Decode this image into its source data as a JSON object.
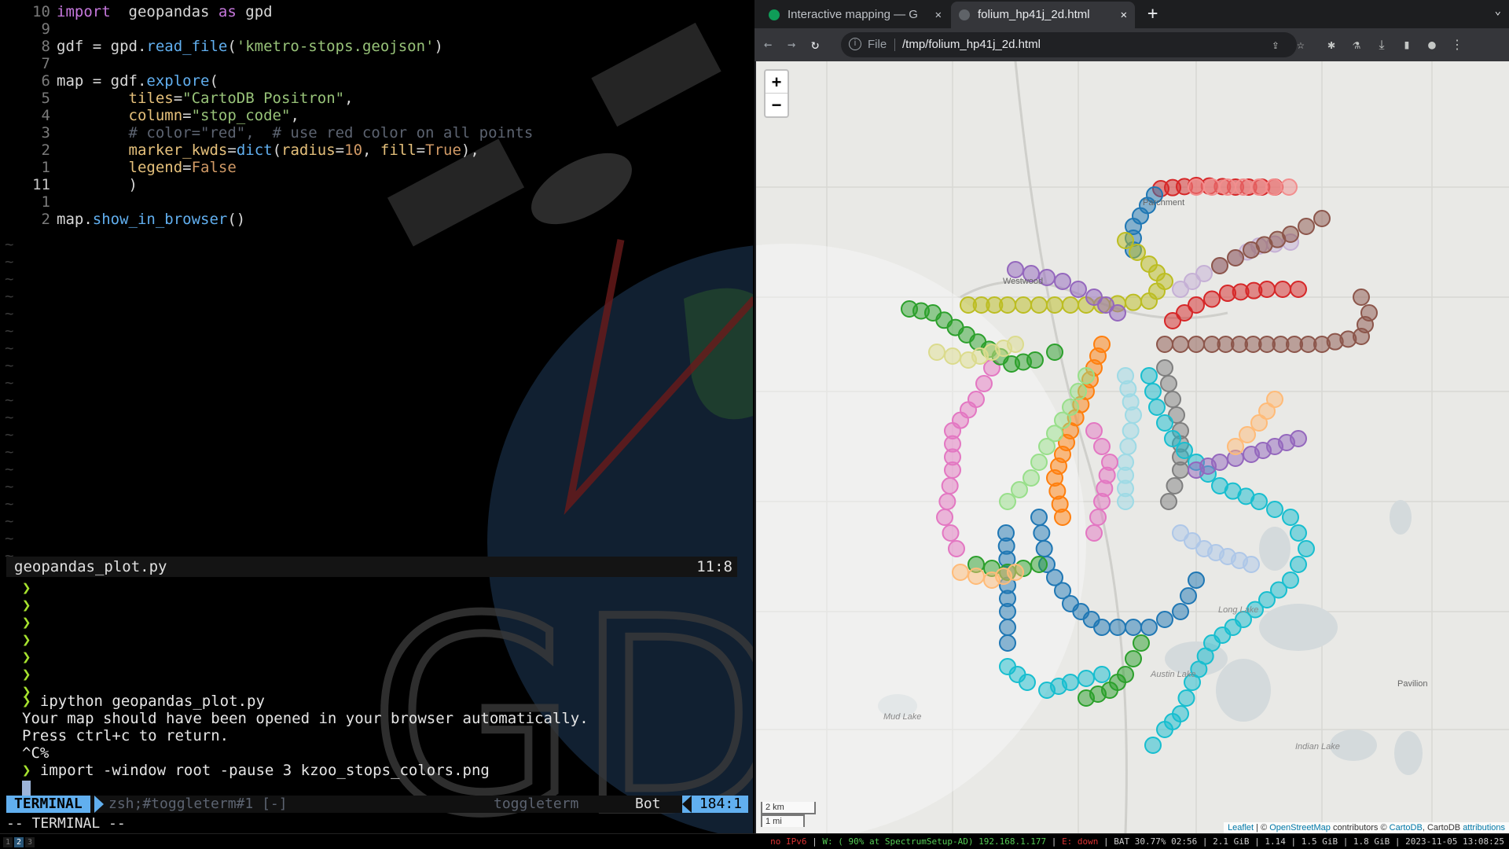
{
  "editor": {
    "lines": [
      {
        "num": "10",
        "parts": [
          [
            "kw",
            "import"
          ],
          [
            "",
            "  geopandas "
          ],
          [
            "kw",
            "as"
          ],
          [
            "",
            " gpd"
          ]
        ]
      },
      {
        "num": "9",
        "parts": []
      },
      {
        "num": "8",
        "parts": [
          [
            "",
            "gdf = gpd."
          ],
          [
            "fn",
            "read_file"
          ],
          [
            "",
            "("
          ],
          [
            "str",
            "'kmetro-stops.geojson'"
          ],
          [
            "",
            ")"
          ]
        ]
      },
      {
        "num": "7",
        "parts": []
      },
      {
        "num": "6",
        "parts": [
          [
            "",
            "map = gdf."
          ],
          [
            "fn",
            "explore"
          ],
          [
            "",
            "("
          ]
        ]
      },
      {
        "num": "5",
        "parts": [
          [
            "",
            "        "
          ],
          [
            "arg",
            "tiles"
          ],
          [
            "",
            "="
          ],
          [
            "str",
            "\"CartoDB Positron\""
          ],
          [
            "",
            ","
          ]
        ]
      },
      {
        "num": "4",
        "parts": [
          [
            "",
            "        "
          ],
          [
            "arg",
            "column"
          ],
          [
            "",
            "="
          ],
          [
            "str",
            "\"stop_code\""
          ],
          [
            "",
            ","
          ]
        ]
      },
      {
        "num": "3",
        "parts": [
          [
            "",
            "        "
          ],
          [
            "cm",
            "# color=\"red\",  # use red color on all points"
          ]
        ]
      },
      {
        "num": "2",
        "parts": [
          [
            "",
            "        "
          ],
          [
            "arg",
            "marker_kwds"
          ],
          [
            "",
            "="
          ],
          [
            "fn",
            "dict"
          ],
          [
            "",
            "("
          ],
          [
            "arg",
            "radius"
          ],
          [
            "",
            "="
          ],
          [
            "num",
            "10"
          ],
          [
            "",
            ", "
          ],
          [
            "arg",
            "fill"
          ],
          [
            "",
            "="
          ],
          [
            "bl",
            "True"
          ],
          [
            "",
            "),"
          ]
        ]
      },
      {
        "num": "1",
        "parts": [
          [
            "",
            "        "
          ],
          [
            "arg",
            "legend"
          ],
          [
            "",
            "="
          ],
          [
            "bl",
            "False"
          ]
        ]
      },
      {
        "num": "11",
        "parts": [
          [
            "",
            "        )"
          ]
        ]
      },
      {
        "num": "1",
        "parts": []
      },
      {
        "num": "2",
        "parts": [
          [
            "",
            "map."
          ],
          [
            "fn",
            "show_in_browser"
          ],
          [
            "",
            "()"
          ]
        ]
      }
    ],
    "filename": "geopandas_plot.py",
    "cursor_pos": "11:8"
  },
  "terminal": {
    "prompt_symbol": "❯",
    "empty_prompts": 7,
    "command1": "ipython geopandas_plot.py",
    "output1": "Your map should have been opened in your browser automatically.",
    "output2": "Press ctrl+c to return.",
    "output3": "^C%",
    "command2": "import -window root -pause 3 kzoo_stops_colors.png",
    "status_mode": "TERMINAL",
    "status_session": "zsh;#toggleterm#1 [-]",
    "status_plugin": "toggleterm",
    "status_scroll": "Bot",
    "status_pos": "184:1",
    "modeline": "-- TERMINAL --"
  },
  "wallpaper": {
    "text": "GDAL"
  },
  "browser": {
    "tabs": [
      {
        "label": "Interactive mapping — G",
        "active": false,
        "fav_color": "#0f9d58"
      },
      {
        "label": "folium_hp41j_2d.html",
        "active": true,
        "fav_color": "#5f6368"
      }
    ],
    "newtab": "+",
    "omnibox_scheme": "File",
    "omnibox_url": "/tmp/folium_hp41j_2d.html"
  },
  "map": {
    "zoom_in": "+",
    "zoom_out": "−",
    "scale_km": "2 km",
    "scale_mi": "1 mi",
    "attribution_leaflet": "Leaflet",
    "attribution_mid": " | © ",
    "attribution_osm": "OpenStreetMap",
    "attribution_tail": " contributors © ",
    "attribution_carto": "CartoDB",
    "attribution_end": ", CartoDB ",
    "attribution_link": "attributions",
    "labels": [
      {
        "text": "Westwood",
        "cls": "place"
      },
      {
        "text": "Parchment",
        "cls": "place"
      },
      {
        "text": "Long Lake",
        "cls": "mlbl"
      },
      {
        "text": "Austin Lake",
        "cls": "mlbl"
      },
      {
        "text": "Mud Lake",
        "cls": "mlbl"
      },
      {
        "text": "Pavilion",
        "cls": "place"
      },
      {
        "text": "Indian Lake",
        "cls": "mlbl"
      }
    ]
  },
  "system": {
    "workspaces": [
      "1",
      "2",
      "3"
    ],
    "active_workspace": "2",
    "ipv6": "no IPv6",
    "wifi": "W: ( 90% at SpectrumSetup-AD) 192.168.1.177",
    "eth": "E: down",
    "rest": "BAT 30.77% 02:56 | 2.1 GiB | 1.14 | 1.5 GiB | 1.8 GiB | 2023-11-05 13:08:25"
  }
}
